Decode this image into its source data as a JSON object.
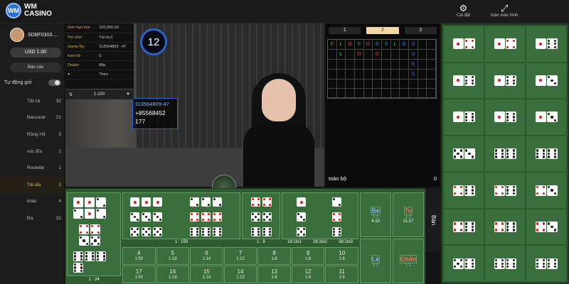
{
  "topbar": {
    "logo_mark": "WM",
    "logo_line1": "WM",
    "logo_line2": "CASINO",
    "settings_label": "Cài đặt",
    "fullscreen_label": "toàn màn hình"
  },
  "sidebar": {
    "username": "SDBF0303....",
    "balance": "USD 1.00",
    "report_label": "Báo cáo",
    "auto_send_label": "Tự động gửi",
    "items": [
      {
        "label": "Tất cả",
        "count": "32"
      },
      {
        "label": "Baccarat",
        "count": "21"
      },
      {
        "label": "Rồng Hổ",
        "count": "3"
      },
      {
        "label": "xóc đĩa",
        "count": "2"
      },
      {
        "label": "Roulette",
        "count": "1"
      },
      {
        "label": "Tài xỉu",
        "count": "1"
      },
      {
        "label": "khác",
        "count": "4"
      },
      {
        "label": "Đa",
        "count": "32"
      }
    ]
  },
  "info": {
    "rows": [
      {
        "k": "Giới hạn bàn",
        "v": "100,000.00"
      },
      {
        "k": "Trò chơi",
        "v": "Tài xiu1"
      },
      {
        "k": "Game No",
        "v": "113564809 - 47"
      },
      {
        "k": "toàn bộ",
        "v": "0"
      },
      {
        "k": "Dealer",
        "v": "Mia"
      },
      {
        "k": "♥",
        "v": "Theo"
      }
    ],
    "bet_range": "1-100"
  },
  "video": {
    "timer": "12",
    "round_id": "113564809-47",
    "round_no": "+85568452",
    "round_count": "177"
  },
  "road": {
    "tabs": [
      "1",
      "2",
      "3"
    ],
    "active_tab": 1,
    "cells": [
      [
        "E",
        "L",
        "O",
        "E",
        "O",
        "B",
        "S",
        "L",
        "B",
        "S",
        "",
        ""
      ],
      [
        "",
        "L",
        "",
        "O",
        "",
        "O",
        "",
        "",
        "",
        "S",
        "",
        ""
      ],
      [
        "",
        "",
        "",
        "",
        "",
        "",
        "",
        "",
        "",
        "S",
        "",
        ""
      ],
      [
        "",
        "",
        "",
        "",
        "",
        "",
        "",
        "",
        "",
        "S",
        "",
        ""
      ],
      [
        "",
        "",
        "",
        "",
        "",
        "",
        "",
        "",
        "",
        "",
        "",
        ""
      ],
      [
        "",
        "",
        "",
        "",
        "",
        "",
        "",
        "",
        "",
        "",
        "",
        ""
      ]
    ],
    "total_label": "toàn bộ",
    "total_value": "0"
  },
  "betting": {
    "side_label": "Bàn",
    "bs": [
      {
        "label": "Bé",
        "sub": "1:1",
        "range": "4-10",
        "color": "blue"
      },
      {
        "label": "To",
        "sub": "1:1",
        "range": "11-17",
        "color": "red"
      },
      {
        "label": "Lẻ",
        "sub": "1:1",
        "range": "",
        "color": "blue"
      },
      {
        "label": "Chẵn",
        "sub": "1:1",
        "range": "",
        "color": "red"
      }
    ],
    "sums": [
      {
        "n": "4",
        "o": "1:50"
      },
      {
        "n": "5",
        "o": "1:18"
      },
      {
        "n": "6",
        "o": "1:14"
      },
      {
        "n": "7",
        "o": "1:12"
      },
      {
        "n": "8",
        "o": "1:8"
      },
      {
        "n": "9",
        "o": "1:6"
      },
      {
        "n": "10",
        "o": "1:6"
      },
      {
        "n": "17",
        "o": "1:50"
      },
      {
        "n": "16",
        "o": "1:18"
      },
      {
        "n": "15",
        "o": "1:14"
      },
      {
        "n": "14",
        "o": "1:12"
      },
      {
        "n": "13",
        "o": "1:8"
      },
      {
        "n": "12",
        "o": "1:6"
      },
      {
        "n": "11",
        "o": "1:6"
      }
    ],
    "triple_any_odds": "1 : 24",
    "triple_odds": "1 : 150",
    "double_odds": "1 : 8",
    "single_odds": [
      "1d:1to1",
      "2d:1to2",
      "3d:1to3"
    ]
  },
  "stats": {
    "rows": [
      [
        [
          1,
          4
        ],
        [
          1,
          4
        ],
        [
          1,
          6
        ]
      ],
      [
        [
          1,
          6
        ],
        [
          1,
          6
        ],
        [
          1,
          3
        ]
      ],
      [
        [
          1,
          6
        ],
        [
          1,
          6
        ],
        [
          1,
          3
        ]
      ],
      [
        [
          5,
          3
        ],
        [
          6,
          6
        ],
        [
          6,
          6
        ]
      ],
      [
        [
          4,
          6
        ],
        [
          4,
          6
        ],
        [
          4,
          3
        ]
      ],
      [
        [
          4,
          6
        ],
        [
          4,
          6
        ],
        [
          4,
          3
        ]
      ],
      [
        [
          5,
          6
        ],
        [
          6,
          6
        ],
        [
          6,
          6
        ]
      ]
    ]
  }
}
